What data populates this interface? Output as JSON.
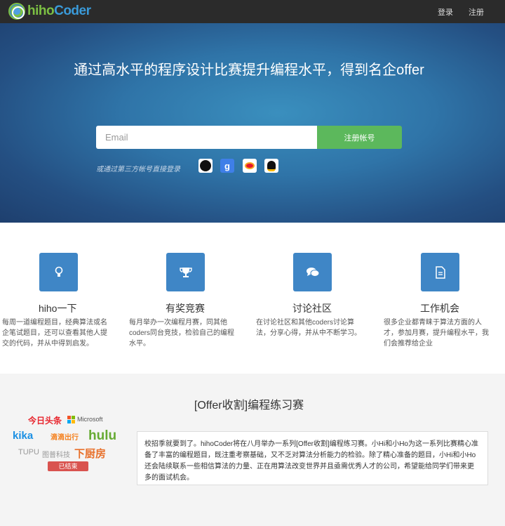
{
  "navbar": {
    "logo_text_hi": "hiho",
    "logo_text_coder": "Coder",
    "login": "登录",
    "register": "注册"
  },
  "hero": {
    "title": "通过高水平的程序设计比赛提升编程水平，得到名企offer",
    "email_placeholder": "Email",
    "signup_button": "注册帐号",
    "third_party_label": "或通过第三方帐号直接登录",
    "social_icons": [
      "github-icon",
      "google-icon",
      "weibo-icon",
      "qq-icon",
      "microsoft-icon"
    ],
    "google_letter": "g"
  },
  "features": [
    {
      "icon": "lightbulb-icon",
      "title": "hiho一下",
      "desc": "每周一道编程题目，经典算法或名企笔试题目，还可以查看其他人提交的代码，并从中得到启发。"
    },
    {
      "icon": "trophy-icon",
      "title": "有奖竞赛",
      "desc": "每月举办一次编程月赛，同其他coders同台竞技，检验自己的编程水平。"
    },
    {
      "icon": "comments-icon",
      "title": "讨论社区",
      "desc": "在讨论社区和其他coders讨论算法，分享心得，并从中不断学习。"
    },
    {
      "icon": "document-icon",
      "title": "工作机会",
      "desc": "很多企业都青睐于算法方面的人才，参加月赛，提升编程水平，我们会推荐给企业"
    }
  ],
  "offer": {
    "title": "[Offer收割]编程练习赛",
    "sponsors": {
      "toutiao": "今日头条",
      "microsoft": "Microsoft",
      "kika": "kika",
      "didi": "滴滴出行",
      "hulu": "hulu",
      "tupu": "TUPU",
      "tupu_cn": "图普科技",
      "xiachufang": "下厨房"
    },
    "status": "已结束",
    "description": "校招季就要到了。hihoCoder将在八月举办一系列[Offer收割]编程练习赛。小Hi和小Ho为这一系列比赛精心准备了丰富的编程题目，既注重考察基础，又不乏对算法分析能力的检验。除了精心准备的题目，小Hi和小Ho还会陆续联系一些相信算法的力量、正在用算法改变世界并且亟需优秀人才的公司，希望能给同学们带来更多的面试机会。"
  },
  "colors": {
    "navbar": "#2b2b2b",
    "accent_green": "#5cb85c",
    "feature_blue": "#3f86c6",
    "ended_red": "#d9534f"
  }
}
